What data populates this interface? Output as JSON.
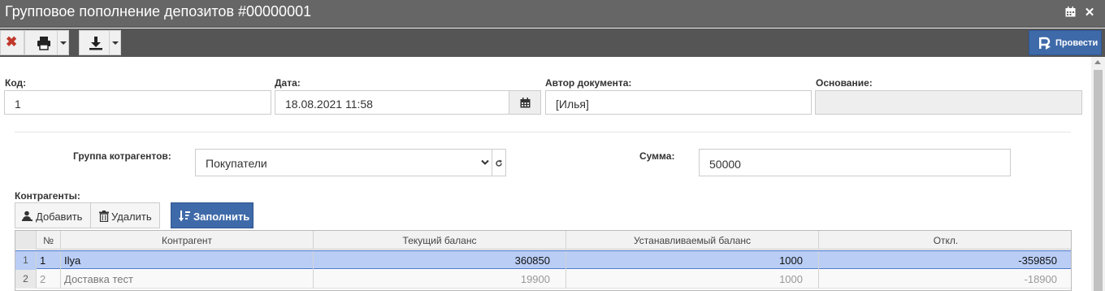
{
  "window": {
    "title": "Групповое пополнение депозитов #00000001"
  },
  "toolbar": {
    "post_label": "Провести"
  },
  "form": {
    "code_label": "Код:",
    "code_value": "1",
    "date_label": "Дата:",
    "date_value": "18.08.2021 11:58",
    "author_label": "Автор документа:",
    "author_value": "[Илья]",
    "basis_label": "Основание:",
    "basis_value": "",
    "group_label": "Группа котрагентов:",
    "group_value": "Покупатели",
    "sum_label": "Сумма:",
    "sum_value": "50000",
    "contractors_label": "Контрагенты:"
  },
  "grid_toolbar": {
    "add_label": "Добавить",
    "delete_label": "Удалить",
    "fill_label": "Заполнить"
  },
  "table": {
    "columns": [
      "№",
      "Контрагент",
      "Текущий баланс",
      "Устанавливаемый баланс",
      "Откл."
    ],
    "rows": [
      {
        "rownum": "1",
        "num": "1",
        "contractor": "Ilya",
        "current": "360850",
        "target": "1000",
        "diff": "-359850"
      },
      {
        "rownum": "2",
        "num": "2",
        "contractor": "Доставка тест",
        "current": "19900",
        "target": "1000",
        "diff": "-18900"
      }
    ]
  },
  "colors": {
    "titlebar": "#666666",
    "toolbar": "#555555",
    "primary": "#3f6aa9",
    "selected_row": "#b9cdf5",
    "close_icon": "#c0392b"
  }
}
